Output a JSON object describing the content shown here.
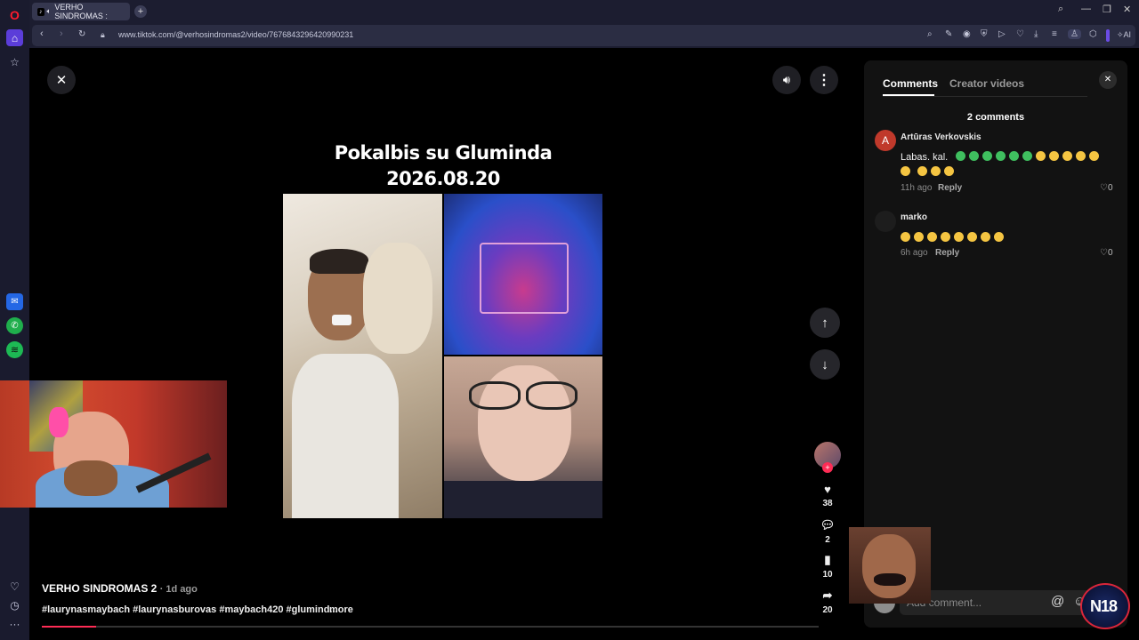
{
  "browser": {
    "tab_title": "VERHO SINDROMAS :",
    "url_domain": "www.tiktok.com",
    "url_path": "/@verhosindromas2/video/7676843296420990231",
    "toolbar_ai_label": "AI"
  },
  "video": {
    "title_line1": "Pokalbis su Gluminda",
    "title_line2": "2026.08.20",
    "author": "VERHO SINDROMAS 2",
    "age": "· 1d ago",
    "hashtags": "#laurynasmaybach #laurynasburovas #maybach420 #glumind...",
    "more_label": "more",
    "likes": "38",
    "comments": "2",
    "saves": "10",
    "shares": "20",
    "progress": 0.07
  },
  "comments_panel": {
    "tab_comments": "Comments",
    "tab_creator": "Creator videos",
    "count_label": "2 comments",
    "items": [
      {
        "avatar_letter": "A",
        "name": "Artūras Verkovskis",
        "text": "Labas. kal.",
        "time": "11h ago",
        "reply": "Reply",
        "likes": "0"
      },
      {
        "avatar_letter": "",
        "name": "marko",
        "text": "",
        "time": "6h ago",
        "reply": "Reply",
        "likes": "0"
      }
    ],
    "input_placeholder": "Add comment..."
  },
  "colors": {
    "accent_red": "#fe2c55",
    "heart_green": "#3fbf5f",
    "laugh_yellow": "#f5c542",
    "avatar_red": "#c0392b"
  },
  "overlay": {
    "badge_text": "N18"
  }
}
